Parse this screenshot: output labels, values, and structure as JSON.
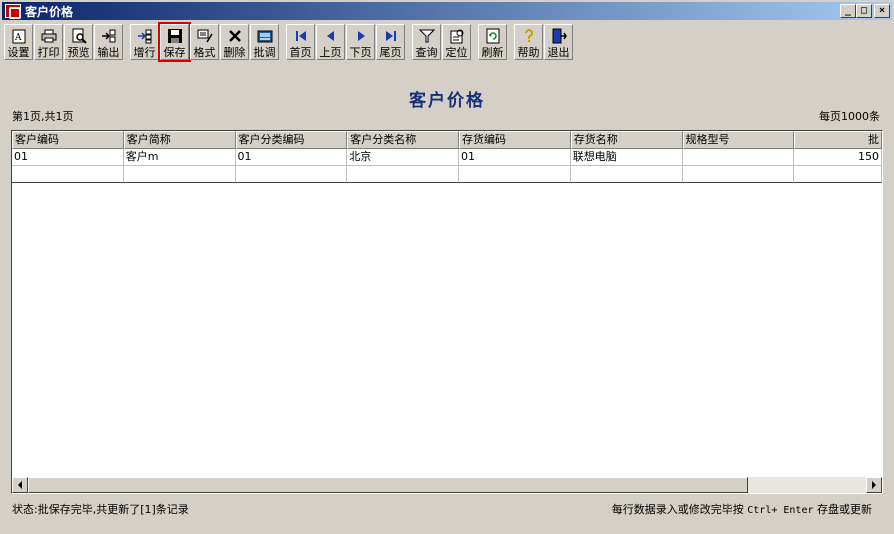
{
  "window": {
    "title": "客户价格",
    "minimize": "_",
    "maximize": "□",
    "close": "×"
  },
  "toolbar": {
    "groups": [
      [
        {
          "label": "设置",
          "icon": "settings-icon"
        },
        {
          "label": "打印",
          "icon": "printer-icon"
        },
        {
          "label": "预览",
          "icon": "preview-icon"
        },
        {
          "label": "输出",
          "icon": "export-icon"
        }
      ],
      [
        {
          "label": "增行",
          "icon": "add-row-icon"
        },
        {
          "label": "保存",
          "icon": "save-icon"
        },
        {
          "label": "格式",
          "icon": "format-icon"
        },
        {
          "label": "删除",
          "icon": "delete-icon"
        },
        {
          "label": "批调",
          "icon": "batch-adjust-icon"
        }
      ],
      [
        {
          "label": "首页",
          "icon": "first-page-icon"
        },
        {
          "label": "上页",
          "icon": "prev-page-icon"
        },
        {
          "label": "下页",
          "icon": "next-page-icon"
        },
        {
          "label": "尾页",
          "icon": "last-page-icon"
        }
      ],
      [
        {
          "label": "查询",
          "icon": "filter-icon"
        },
        {
          "label": "定位",
          "icon": "locate-icon"
        }
      ],
      [
        {
          "label": "刷新",
          "icon": "refresh-icon"
        }
      ],
      [
        {
          "label": "帮助",
          "icon": "help-icon"
        },
        {
          "label": "退出",
          "icon": "exit-icon"
        }
      ]
    ]
  },
  "report": {
    "title": "客户价格",
    "page_info": "第1页,共1页",
    "per_page": "每页1000条"
  },
  "grid": {
    "columns": [
      "客户编码",
      "客户简称",
      "客户分类编码",
      "客户分类名称",
      "存货编码",
      "存货名称",
      "规格型号",
      "批"
    ],
    "rows": [
      [
        "01",
        "客户m",
        "01",
        "北京",
        "01",
        "联想电脑",
        "",
        "150"
      ]
    ]
  },
  "status": {
    "left": "状态:批保存完毕,共更新了[1]条记录",
    "right_prefix": "每行数据录入或修改完毕按 ",
    "right_key": "Ctrl+ Enter",
    "right_suffix": " 存盘或更新"
  }
}
